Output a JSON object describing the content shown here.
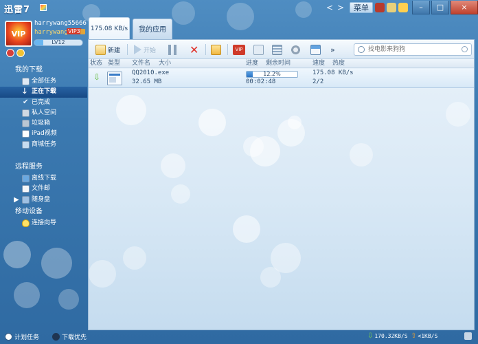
{
  "app": {
    "title": "迅雷7"
  },
  "titlebar": {
    "menu_label": "菜单",
    "nav_back": "<",
    "nav_fwd": ">",
    "minimize": "–",
    "maximize": "□",
    "close": "×"
  },
  "user": {
    "username": "harrywang55666",
    "nickname": "harrywang",
    "vip_tag": "VIP3",
    "level": "LV12",
    "level_progress": 0.18,
    "avatar_text": "VIP"
  },
  "sidebar": {
    "my_downloads": "我的下载",
    "items": [
      {
        "label": "全部任务",
        "icon": "page-icon"
      },
      {
        "label": "正在下载",
        "icon": "down-arrow-icon"
      },
      {
        "label": "已完成",
        "icon": "check-icon"
      },
      {
        "label": "私人空间",
        "icon": "lock-icon"
      },
      {
        "label": "垃圾箱",
        "icon": "trash-icon"
      },
      {
        "label": "iPad视频",
        "icon": "ipad-icon"
      },
      {
        "label": "商城任务",
        "icon": "shop-icon"
      }
    ],
    "remote_service": "远程服务",
    "remote_items": [
      {
        "label": "离线下载",
        "icon": "offline-download-icon"
      },
      {
        "label": "文件邮",
        "icon": "mail-icon"
      },
      {
        "label": "随身盘",
        "icon": "disk-icon"
      }
    ],
    "mobile_devices": "移动设备",
    "mobile_items": [
      {
        "label": "连接向导",
        "icon": "bulb-icon"
      }
    ]
  },
  "tabs": {
    "speed_tab": "175.08 KB/s",
    "apps_tab": "我的应用"
  },
  "toolbar": {
    "new_label": "新建",
    "start_label": "开始",
    "search_placeholder": "找电影来狗狗"
  },
  "columns": {
    "status": "状态",
    "type": "类型",
    "filename": "文件名",
    "size": "大小",
    "progress": "进度",
    "remaining": "剩余时间",
    "speed": "速度",
    "heat": "热度"
  },
  "tasks": [
    {
      "filename": "QQ2010.exe",
      "size": "32.65 MB",
      "progress": 0.122,
      "progress_text": "12.2%",
      "remaining": "00:02:48",
      "speed": "175.08 KB/s",
      "heat": "2/2"
    }
  ],
  "bottombar": {
    "schedule": "计划任务",
    "priority": "下载优先",
    "down_speed": "170.32KB/S",
    "up_speed": "<1KB/S"
  },
  "colors": {
    "window_blue": "#3b79b0",
    "panel_bg": "#e9f2fa",
    "accent": "#2b73c2",
    "delete_red": "#e0322a",
    "vip_red": "#d63b2a"
  }
}
